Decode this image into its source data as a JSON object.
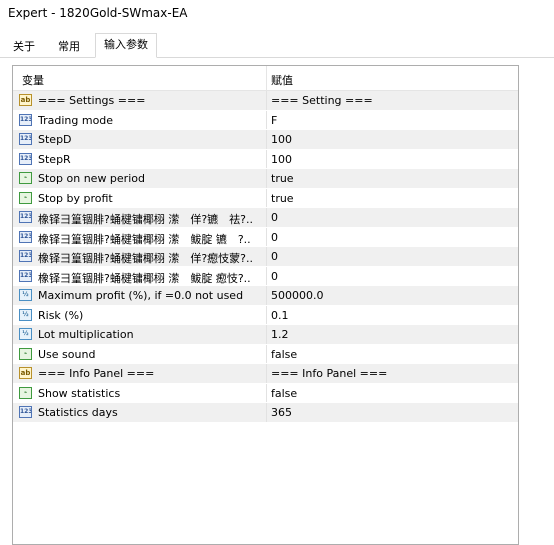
{
  "window": {
    "title": "Expert - 1820Gold-SWmax-EA"
  },
  "tabs": [
    {
      "label": "关于",
      "active": false
    },
    {
      "label": "常用",
      "active": false
    },
    {
      "label": "输入参数",
      "active": true
    }
  ],
  "table": {
    "headers": {
      "variable": "变量",
      "value": "赋值"
    },
    "rows": [
      {
        "icon": "string-icon",
        "type": "ab",
        "name": "=== Settings ===",
        "value": "=== Setting ==="
      },
      {
        "icon": "integer-icon",
        "type": "123",
        "name": "Trading mode",
        "value": "F"
      },
      {
        "icon": "integer-icon",
        "type": "123",
        "name": "StepD",
        "value": "100"
      },
      {
        "icon": "integer-icon",
        "type": "123",
        "name": "StepR",
        "value": "100"
      },
      {
        "icon": "boolean-icon",
        "type": "bool",
        "name": "Stop on new period",
        "value": "true"
      },
      {
        "icon": "boolean-icon",
        "type": "bool",
        "name": "Stop by profit",
        "value": "true"
      },
      {
        "icon": "integer-icon",
        "type": "123",
        "name": "橡铎彐篁锢腓?蛹楗镛椰栩 潆　佯?镳　祛?..",
        "value": "0"
      },
      {
        "icon": "integer-icon",
        "type": "123",
        "name": "橡铎彐篁锢腓?蛹楗镛椰栩 潆　鲅腚 镳　?..",
        "value": "0"
      },
      {
        "icon": "integer-icon",
        "type": "123",
        "name": "橡铎彐篁锢腓?蛹楗镛椰栩 潆　佯?瘛忮蒙?..",
        "value": "0"
      },
      {
        "icon": "integer-icon",
        "type": "123",
        "name": "橡铎彐篁锢腓?蛹楗镛椰栩 潆　鲅腚 瘛忮?..",
        "value": "0"
      },
      {
        "icon": "double-icon",
        "type": "dbl",
        "name": "Maximum profit (%), if =0.0 not used",
        "value": "500000.0"
      },
      {
        "icon": "double-icon",
        "type": "dbl",
        "name": "Risk (%)",
        "value": "0.1"
      },
      {
        "icon": "double-icon",
        "type": "dbl",
        "name": "Lot multiplication",
        "value": "1.2"
      },
      {
        "icon": "boolean-icon",
        "type": "bool",
        "name": "Use sound",
        "value": "false"
      },
      {
        "icon": "string-icon",
        "type": "ab",
        "name": "=== Info Panel ===",
        "value": "=== Info Panel ==="
      },
      {
        "icon": "boolean-icon",
        "type": "bool",
        "name": "Show statistics",
        "value": "false"
      },
      {
        "icon": "integer-icon",
        "type": "123",
        "name": "Statistics days",
        "value": "365"
      }
    ]
  }
}
